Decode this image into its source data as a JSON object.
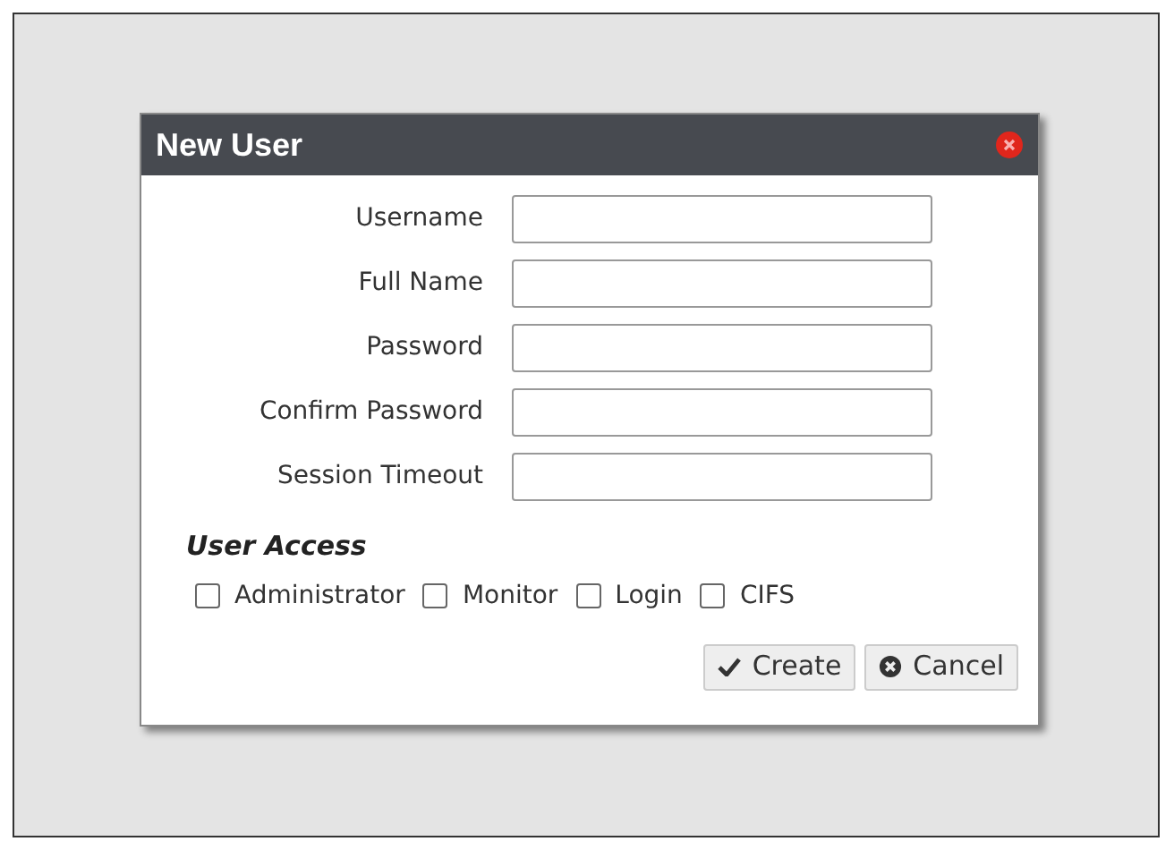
{
  "dialog": {
    "title": "New User",
    "fields": [
      {
        "label": "Username"
      },
      {
        "label": "Full Name"
      },
      {
        "label": "Password"
      },
      {
        "label": "Confirm Password"
      },
      {
        "label": "Session Timeout"
      }
    ],
    "access_title": "User Access",
    "access": [
      {
        "label": "Administrator",
        "checked": false
      },
      {
        "label": "Monitor",
        "checked": false
      },
      {
        "label": "Login",
        "checked": false
      },
      {
        "label": "CIFS",
        "checked": false
      }
    ],
    "buttons": [
      {
        "kind": "create",
        "label": "Create"
      },
      {
        "kind": "cancel",
        "label": "Cancel"
      }
    ]
  }
}
